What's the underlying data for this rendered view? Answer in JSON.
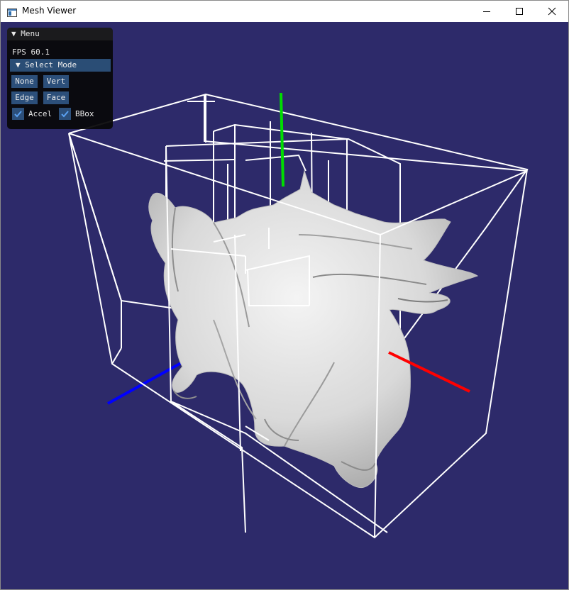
{
  "window": {
    "title": "Mesh Viewer",
    "icon": "app-window-icon",
    "controls": [
      "minimize-icon",
      "maximize-icon",
      "close-icon"
    ]
  },
  "viewport": {
    "background": "#2d2a6a",
    "axes": {
      "x_color": "#ff0000",
      "y_color": "#00dd00",
      "z_color": "#0000ff"
    },
    "wireframe_color": "#ffffff",
    "mesh": "dragon"
  },
  "menu": {
    "header_label": "▼ Menu",
    "fps_text": "FPS 60.1",
    "section_label": "▼ Select Mode",
    "buttons": {
      "none": "None",
      "vert": "Vert",
      "edge": "Edge",
      "face": "Face"
    },
    "checkboxes": {
      "accel": {
        "label": "Accel",
        "checked": true
      },
      "bbox": {
        "label": "BBox",
        "checked": true
      }
    },
    "accent": "#2c4f7a"
  }
}
